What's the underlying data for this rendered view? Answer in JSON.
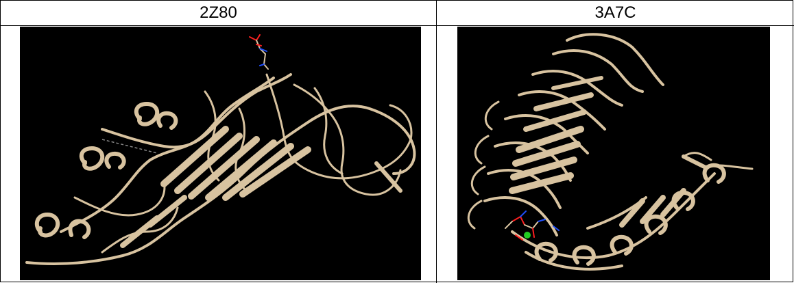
{
  "table": {
    "columns": [
      {
        "header": "2Z80",
        "image": "protein-ribbon-structure"
      },
      {
        "header": "3A7C",
        "image": "protein-ribbon-structure"
      }
    ]
  },
  "colors": {
    "ribbon": "#d8c3a0",
    "background": "#000000",
    "ligand_red": "#ff2020",
    "ligand_blue": "#2050ff",
    "ion_green": "#22cc22"
  }
}
